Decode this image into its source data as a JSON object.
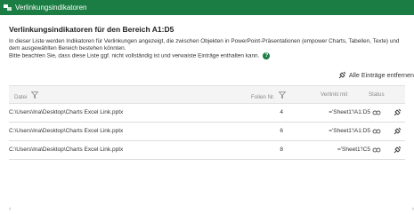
{
  "window": {
    "title": "Verlinkungsindikatoren"
  },
  "heading": "Verlinkungsindikatoren für den Bereich A1:D5",
  "description": {
    "line1": "In dieser Liste werden Indikatoren für Verlinkungen angezeigt, die zwischen Objekten in PowerPoint-Präsentationen (empower Charts, Tabellen, Texte) und",
    "line2": "dem ausgewählten Bereich bestehen könnten.",
    "line3": "Bitte beachten Sie, dass diese Liste ggf. nicht vollständig ist und verwaiste Einträge enthalten kann.",
    "help_icon": "?"
  },
  "toolbar": {
    "remove_all_label": "Alle Einträge entfernen"
  },
  "table": {
    "headers": {
      "file": "Datei",
      "slide": "Folien Nr.",
      "linked": "Verlinkt mit",
      "status": "Status"
    },
    "rows": [
      {
        "file": "C:\\Users\\Ina\\Desktop\\Charts Excel Link.pptx",
        "slide": "4",
        "linked": "='Sheet1'!A1:D5"
      },
      {
        "file": "C:\\Users\\Ina\\Desktop\\Charts Excel Link.pptx",
        "slide": "6",
        "linked": "='Sheet1'!A1:D5"
      },
      {
        "file": "C:\\Users\\Ina\\Desktop\\Charts Excel Link.pptx",
        "slide": "8",
        "linked": "='Sheet1'!C5"
      }
    ]
  },
  "colors": {
    "accent": "#1b7d43",
    "header_bg": "#f4f4f4",
    "border": "#dcdcdc"
  },
  "icons": {
    "titlebar": "app-icon",
    "filter": "filter-icon",
    "status": "link-icon",
    "action": "unlink-icon"
  }
}
